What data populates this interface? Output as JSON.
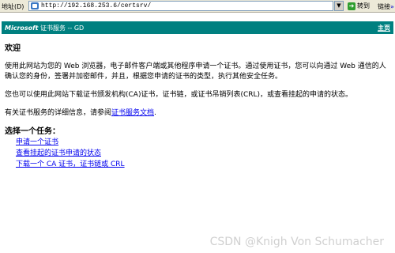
{
  "addressbar": {
    "label": "地址(D)",
    "url": "http://192.168.253.6/certsrv/",
    "dropdown_glyph": "▼",
    "go_label": "转到",
    "links_label": "链接",
    "links_chevron": "»"
  },
  "header": {
    "brand_ms": "Microsoft",
    "brand_rest": " 证书服务  --  GD",
    "home_link": "主页",
    "bg_color": "#008080"
  },
  "welcome": {
    "title": "欢迎",
    "paragraph1": "使用此网站为您的 Web 浏览器，电子邮件客户端或其他程序申请一个证书。通过使用证书，您可以向通过 Web 通信的人确认您的身份，签署并加密邮件，并且，根据您申请的证书的类型，执行其他安全任务。",
    "paragraph2": "您也可以使用此网站下载证书颁发机构(CA)证书，证书链，或证书吊销列表(CRL)，或查看挂起的申请的状态。",
    "paragraph3_prefix": "有关证书服务的详细信息，请参阅",
    "paragraph3_link": "证书服务文档",
    "paragraph3_suffix": "."
  },
  "tasks": {
    "title": "选择一个任务：",
    "items": [
      "申请一个证书",
      "查看挂起的证书申请的状态",
      "下载一个 CA 证书，证书链或 CRL"
    ]
  },
  "watermark": "CSDN @Knigh Von Schumacher",
  "colors": {
    "link": "#0000ee",
    "chrome": "#ece9d8"
  }
}
